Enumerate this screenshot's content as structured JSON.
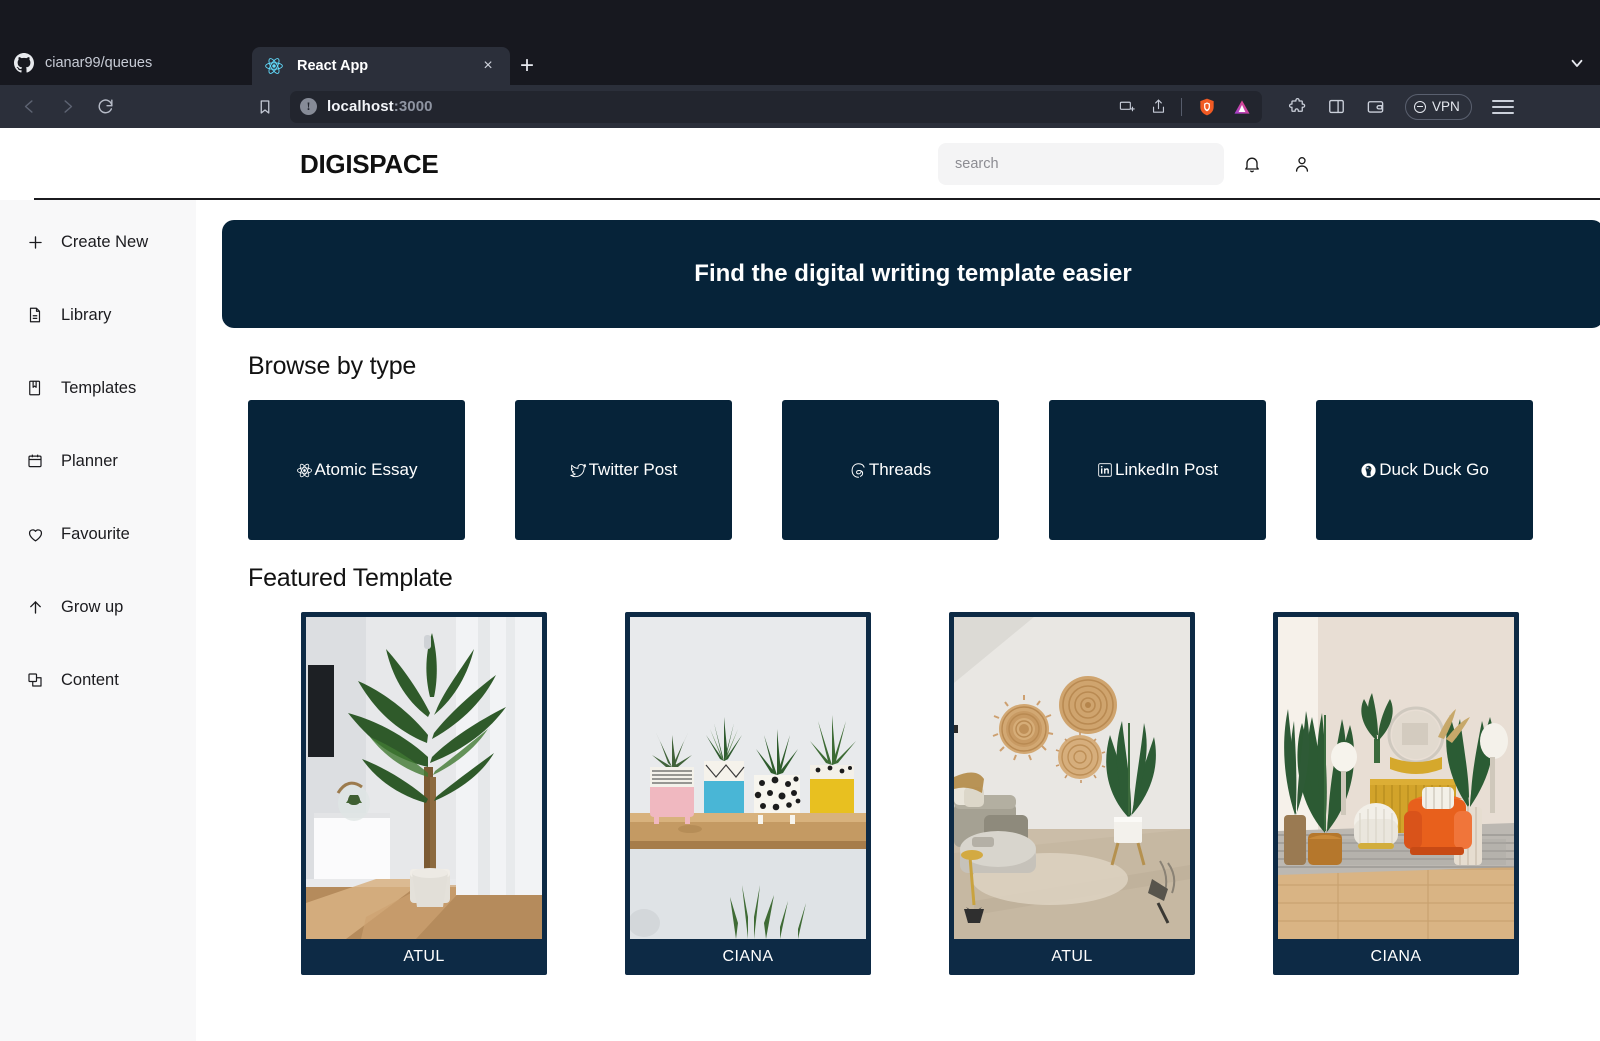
{
  "browser": {
    "tabs": [
      {
        "title": "cianar99/queues",
        "icon": "github-icon",
        "active": false
      },
      {
        "title": "React App",
        "icon": "react-icon",
        "active": true
      }
    ],
    "new_tab_label": "+",
    "close_label": "×",
    "url": {
      "host": "localhost",
      "port": ":3000"
    },
    "vpn_label": "VPN",
    "toolbar_icons": [
      "cast-icon",
      "share-icon",
      "brave-shields-icon",
      "brave-rewards-icon",
      "extensions-icon",
      "sidebar-icon",
      "wallet-icon",
      "menu-icon"
    ],
    "nav_icons": [
      "back-icon",
      "forward-icon",
      "reload-icon",
      "bookmark-icon"
    ]
  },
  "app": {
    "logo": "DIGISPACE",
    "search": {
      "placeholder": "search",
      "value": ""
    },
    "header_icons": [
      "bell-icon",
      "user-icon"
    ],
    "sidebar": {
      "items": [
        {
          "label": "Create New",
          "icon": "plus-icon"
        },
        {
          "label": "Library",
          "icon": "file-icon"
        },
        {
          "label": "Templates",
          "icon": "book-icon"
        },
        {
          "label": "Planner",
          "icon": "calendar-icon"
        },
        {
          "label": "Favourite",
          "icon": "heart-icon"
        },
        {
          "label": "Grow up",
          "icon": "arrow-up-icon"
        },
        {
          "label": "Content",
          "icon": "copy-icon"
        }
      ]
    },
    "hero": {
      "headline": "Find the digital writing template easier"
    },
    "browse": {
      "title": "Browse by type",
      "cards": [
        {
          "label": "Atomic Essay",
          "icon": "react-atom-icon"
        },
        {
          "label": "Twitter Post",
          "icon": "twitter-bird-icon"
        },
        {
          "label": "Threads",
          "icon": "threads-icon"
        },
        {
          "label": "LinkedIn Post",
          "icon": "linkedin-icon"
        },
        {
          "label": "Duck Duck Go",
          "icon": "duckduckgo-icon"
        }
      ]
    },
    "featured": {
      "title": "Featured Template",
      "cards": [
        {
          "label": "ATUL",
          "image": "palm-plant-in-living-room"
        },
        {
          "label": "CIANA",
          "image": "succulents-on-wood-shelf"
        },
        {
          "label": "ATUL",
          "image": "woven-baskets-on-wall-lounge"
        },
        {
          "label": "CIANA",
          "image": "orange-armchair-interior"
        }
      ]
    },
    "colors": {
      "navy": "#062339",
      "card_frame": "#0d2a45",
      "sidebar_bg": "#f8f8f9",
      "search_bg": "#f4f4f5",
      "text": "#121212"
    }
  }
}
